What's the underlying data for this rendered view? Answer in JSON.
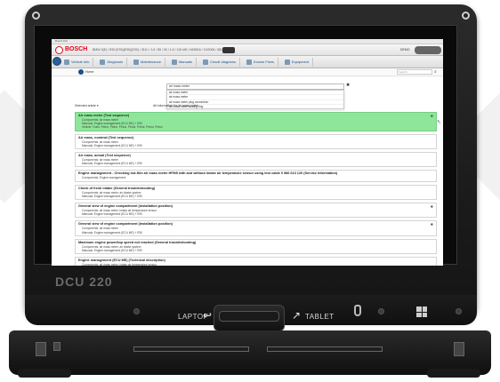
{
  "device": {
    "model_label": "DCU 220",
    "laptop_label": "LAPTOP",
    "tablet_label": "TABLET"
  },
  "app": {
    "top_title": "Bosch ESI",
    "brand": "BOSCH",
    "vehicle_info": "BMW 3(E) / E90 (E90)(E90)(E90) / 316 i / 1.6 / 85 / 90 / 1.6 / 115 kW / N43B16 / 10/2006 / 08/2011",
    "user": "DEMO",
    "nav": [
      {
        "label": "Vehicle info",
        "icon": "car-icon"
      },
      {
        "label": "Diagnosis",
        "icon": "diagnosis-icon"
      },
      {
        "label": "Maintenance",
        "icon": "wrench-icon"
      },
      {
        "label": "Manuals",
        "icon": "book-icon"
      },
      {
        "label": "Circuit diagrams",
        "icon": "circuit-icon"
      },
      {
        "label": "Known Fixes",
        "icon": "fix-icon"
      },
      {
        "label": "Equipment",
        "icon": "equipment-icon"
      }
    ],
    "home_label": "Home",
    "global_search_placeholder": "Search...",
    "query_value": "air mass meter",
    "suggestions": [
      "air mass meter",
      "air mass meter",
      "air mass meter plug connection",
      "air mass meter sealing ring"
    ],
    "selected_article": "Selected article ▾",
    "all_info": "All information for  air mass meter"
  },
  "results": [
    {
      "title": "Air mass meter (Test sequence)",
      "lines": [
        "Components: air mass meter",
        "Manuals: Engine management (ECU ME) + E90",
        "Vehicle: Fuels, Petrol, Petrol, Petrol, Petrol, Petrol, Petrol, Petrol"
      ],
      "highlight": true
    },
    {
      "title": "Air mass, nominal (Test sequence)",
      "lines": [
        "Components: air mass meter",
        "Manuals: Engine management (ECU ME) + E90"
      ],
      "highlight": false
    },
    {
      "title": "Air mass, actual (Test sequence)",
      "lines": [
        "Components: air mass meter",
        "Manuals: Engine management (ECU ME) + E90"
      ],
      "highlight": false
    },
    {
      "title": "Engine management - Checking hot-film air mass meter HFM5 with and without intake air temperature sensor using test cable 0 986 613 120 (Service information)",
      "lines": [
        "Components: Engine management"
      ],
      "highlight": false
    },
    {
      "title": "Check of fresh intake (General troubleshooting)",
      "lines": [
        "Components: air mass meter, air intake system",
        "Manuals: Engine management (ECU ME) + E90"
      ],
      "highlight": false
    },
    {
      "title": "General view of engine compartment (Installation position)",
      "lines": [
        "Components: air mass meter, intake air temperature sensor",
        "Manuals: Engine management (ECU ME) + E90"
      ],
      "highlight": false
    },
    {
      "title": "General view of engine compartment (Installation position)",
      "lines": [
        "Components: air mass meter",
        "Manuals: Engine management (ECU ME) + E90"
      ],
      "highlight": false
    },
    {
      "title": "Maximum engine power/top speed not reached (General troubleshooting)",
      "lines": [
        "Components: air mass meter, air intake system",
        "Manuals: Engine management (ECU ME) + E90"
      ],
      "highlight": false
    },
    {
      "title": "Engine management (ECU ME) (Technical description)",
      "lines": [
        "Components: air mass meter, intake air temperature sensor",
        "Manuals: Engine management (ECU ME) + E90"
      ],
      "highlight": false
    }
  ]
}
